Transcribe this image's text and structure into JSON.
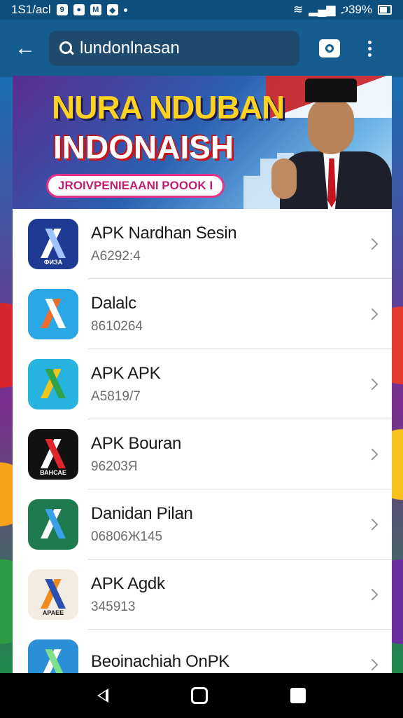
{
  "status_bar": {
    "time": "1S1/acl",
    "battery": "ጋ39%"
  },
  "app_bar": {
    "back_icon": "arrow-left-icon",
    "search_value": "lundonlnasan",
    "lens_icon": "image-search-icon",
    "menu_icon": "more-vert-icon"
  },
  "banner": {
    "title_line1": "NURA NDUBAN",
    "title_line2": "INDONAISH",
    "pill_text": "JROIVPENIEAANI POOOK I"
  },
  "apps": [
    {
      "name": "APK Nardhan Sesin",
      "sub": "A6292:4",
      "icon_color": "#1f3a93",
      "icon_label": "ФИЗА"
    },
    {
      "name": "Dalalc",
      "sub": "8610264",
      "icon_color": "#2aa7e6",
      "icon_label": ""
    },
    {
      "name": "APK APK",
      "sub": "A5819/7",
      "icon_color": "#27b3e0",
      "icon_label": ""
    },
    {
      "name": "APK Bouran",
      "sub": "96203Я",
      "icon_color": "#111111",
      "icon_label": "ВАНСАЕ"
    },
    {
      "name": "Danidan Pilan",
      "sub": "06806Ж145",
      "icon_color": "#1e7a4f",
      "icon_label": ""
    },
    {
      "name": "APK Agdk",
      "sub": "345913",
      "icon_color": "#f3ece2",
      "icon_label": "APAEE"
    },
    {
      "name": "Beoinachiah OnPK",
      "sub": "",
      "icon_color": "#2a8fd6",
      "icon_label": ""
    }
  ],
  "nav": {
    "back_icon": "nav-back-icon",
    "home_icon": "nav-home-icon",
    "recents_icon": "nav-recents-icon"
  }
}
